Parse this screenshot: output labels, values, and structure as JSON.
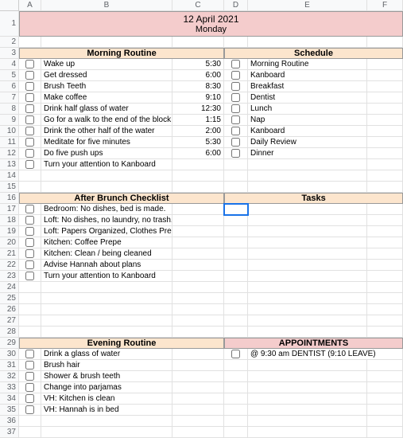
{
  "cols": [
    "A",
    "B",
    "C",
    "D",
    "E",
    "F"
  ],
  "title": {
    "date": "12 April 2021",
    "day": "Monday"
  },
  "sections": {
    "morning": "Morning Routine",
    "schedule": "Schedule",
    "afterBrunch": "After Brunch Checklist",
    "tasks": "Tasks",
    "evening": "Evening Routine",
    "appointments": "APPOINTMENTS"
  },
  "morning": [
    {
      "txt": "Wake up",
      "time": "5:30"
    },
    {
      "txt": "Get dressed",
      "time": "6:00"
    },
    {
      "txt": "Brush Teeth",
      "time": "8:30"
    },
    {
      "txt": "Make coffee",
      "time": "9:10"
    },
    {
      "txt": "Drink half glass of water",
      "time": "12:30"
    },
    {
      "txt": "Go for a walk to the end of the block",
      "time": "1:15"
    },
    {
      "txt": "Drink the other half of the water",
      "time": "2:00"
    },
    {
      "txt": "Meditate for five minutes",
      "time": "5:30"
    },
    {
      "txt": "Do five push ups",
      "time": "6:00"
    },
    {
      "txt": "Turn your attention to Kanboard",
      "time": ""
    }
  ],
  "schedule": [
    "Morning Routine",
    "Kanboard",
    "Breakfast",
    "Dentist",
    "Lunch",
    "Nap",
    "Kanboard",
    "Daily Review",
    "Dinner"
  ],
  "afterBrunch": [
    "Bedroom: No dishes, bed is made.",
    "Loft: No dishes, no laundry, no trash.",
    "Loft: Papers Organized, Clothes Preped",
    "Kitchen: Coffee Prepe",
    "Kitchen: Clean / being cleaned",
    "Advise Hannah about plans",
    "Turn your attention to Kanboard"
  ],
  "evening": [
    "Drink a glass of water",
    "Brush hair",
    "Shower & brush teeth",
    "Change into parjamas",
    "VH: Kitchen is clean",
    "VH: Hannah is in bed"
  ],
  "appointment": "@ 9:30 am DENTIST (9:10 LEAVE)"
}
